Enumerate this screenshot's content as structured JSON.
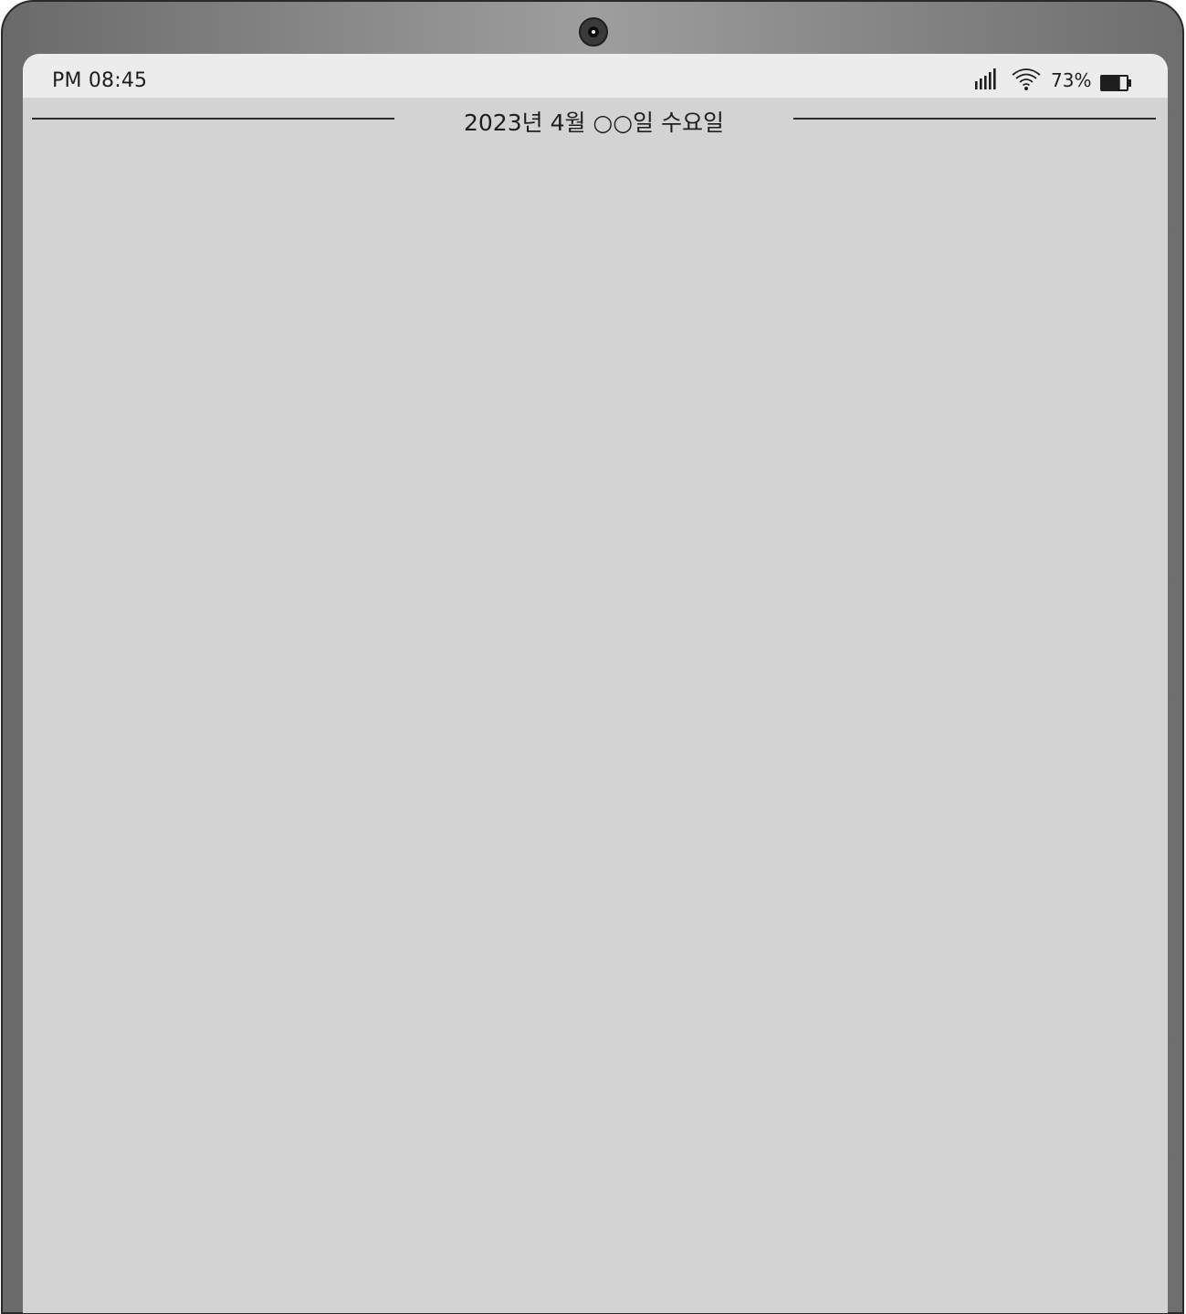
{
  "status_bar": {
    "time": "PM 08:45",
    "signal_icon": "signal-icon",
    "wifi_icon": "wifi-icon",
    "battery_percent": "73%",
    "battery_icon": "battery-icon",
    "battery_level": 0.73
  },
  "header": {
    "date": "2023년 4월 ○○일 수요일"
  },
  "colors": {
    "screen_bg": "#d3d3d3",
    "status_bar_bg": "#ececec",
    "bezel": "#8a8a8a",
    "text": "#1e1e1e"
  }
}
